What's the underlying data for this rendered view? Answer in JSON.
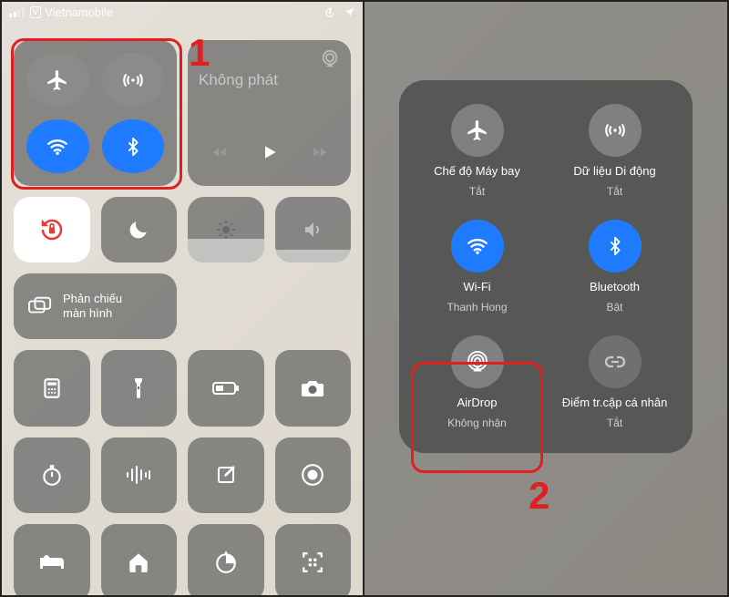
{
  "panel1": {
    "status": {
      "carrier": "Vietnamobile",
      "v_indicator": "V"
    },
    "music": {
      "label": "Không phát"
    },
    "screen_mirror": {
      "line1": "Phản chiếu",
      "line2": "màn hình"
    },
    "step": "1"
  },
  "panel2": {
    "items": {
      "airplane": {
        "title": "Chế độ Máy bay",
        "sub": "Tắt"
      },
      "cellular": {
        "title": "Dữ liệu Di động",
        "sub": "Tắt"
      },
      "wifi": {
        "title": "Wi-Fi",
        "sub": "Thanh Hong"
      },
      "bluetooth": {
        "title": "Bluetooth",
        "sub": "Bật"
      },
      "airdrop": {
        "title": "AirDrop",
        "sub": "Không nhận"
      },
      "hotspot": {
        "title": "Điểm tr.cập cá nhân",
        "sub": "Tắt"
      }
    },
    "step": "2"
  }
}
